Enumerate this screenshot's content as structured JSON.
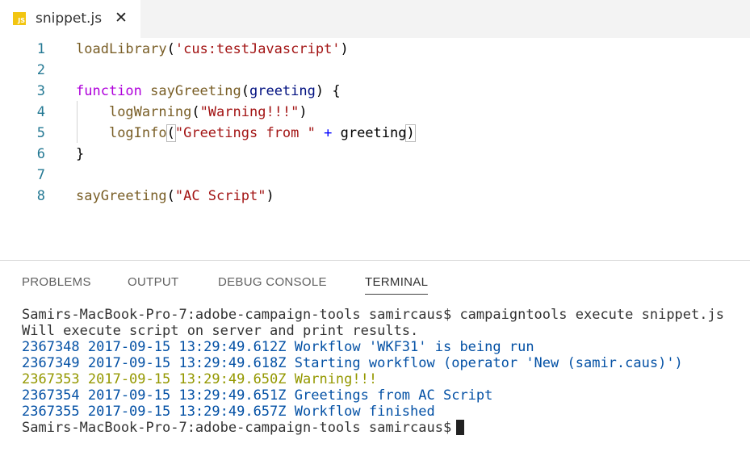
{
  "tab": {
    "icon_label": "JS",
    "file_name": "snippet.js",
    "close_glyph": "✕"
  },
  "editor": {
    "line_numbers": [
      "1",
      "2",
      "3",
      "4",
      "5",
      "6",
      "7",
      "8"
    ],
    "lines": [
      {
        "tokens": [
          [
            "fn",
            "loadLibrary"
          ],
          [
            "txt",
            "("
          ],
          [
            "str",
            "'cus:testJavascript'"
          ],
          [
            "txt",
            ")"
          ]
        ]
      },
      {
        "tokens": []
      },
      {
        "tokens": [
          [
            "kw2",
            "function"
          ],
          [
            "txt",
            " "
          ],
          [
            "fnname",
            "sayGreeting"
          ],
          [
            "txt",
            "("
          ],
          [
            "param",
            "greeting"
          ],
          [
            "txt",
            ") {"
          ]
        ]
      },
      {
        "tokens": [
          [
            "txt",
            "    "
          ],
          [
            "fn",
            "logWarning"
          ],
          [
            "txt",
            "("
          ],
          [
            "str",
            "\"Warning!!!\""
          ],
          [
            "txt",
            ")"
          ]
        ]
      },
      {
        "tokens": [
          [
            "txt",
            "    "
          ],
          [
            "fn",
            "logInfo"
          ],
          [
            "br",
            "("
          ],
          [
            "str",
            "\"Greetings from \""
          ],
          [
            "txt",
            " "
          ],
          [
            "kw",
            "+"
          ],
          [
            "txt",
            " greeting"
          ],
          [
            "br",
            ")"
          ]
        ]
      },
      {
        "tokens": [
          [
            "txt",
            "}"
          ]
        ]
      },
      {
        "tokens": []
      },
      {
        "tokens": [
          [
            "fn",
            "sayGreeting"
          ],
          [
            "txt",
            "("
          ],
          [
            "str",
            "\"AC Script\""
          ],
          [
            "txt",
            ")"
          ]
        ]
      }
    ]
  },
  "panel": {
    "tabs": [
      "PROBLEMS",
      "OUTPUT",
      "DEBUG CONSOLE",
      "TERMINAL"
    ],
    "active_tab": "TERMINAL"
  },
  "terminal": {
    "lines": [
      {
        "style": "default",
        "text": "Samirs-MacBook-Pro-7:adobe-campaign-tools samircaus$ campaigntools execute snippet.js"
      },
      {
        "style": "default",
        "text": "Will execute script on server and print results."
      },
      {
        "style": "blue",
        "text": "2367348 2017-09-15 13:29:49.612Z Workflow 'WKF31' is being run"
      },
      {
        "style": "blue",
        "text": "2367349 2017-09-15 13:29:49.618Z Starting workflow (operator 'New (samir.caus)')"
      },
      {
        "style": "yellow",
        "text": "2367353 2017-09-15 13:29:49.650Z Warning!!!"
      },
      {
        "style": "blue",
        "text": "2367354 2017-09-15 13:29:49.651Z Greetings from AC Script"
      },
      {
        "style": "blue",
        "text": "2367355 2017-09-15 13:29:49.657Z Workflow finished"
      }
    ],
    "prompt": "Samirs-MacBook-Pro-7:adobe-campaign-tools samircaus$"
  },
  "colors": {
    "js_icon": "#f2c511",
    "line_number": "#237893",
    "terminal_blue": "#0451a5",
    "terminal_yellow": "#949800"
  }
}
